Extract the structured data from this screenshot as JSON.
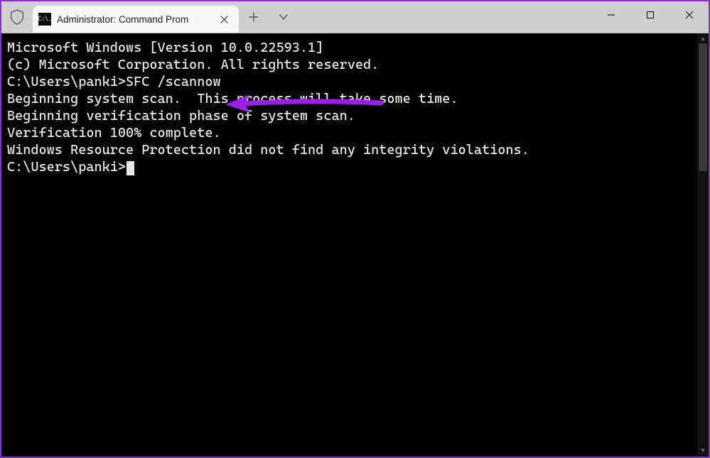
{
  "window": {
    "tab_title": "Administrator: Command Prom",
    "tab_icon_text": "C:\\."
  },
  "annotation": {
    "arrow_color": "#9b1fe8"
  },
  "terminal": {
    "lines": [
      "Microsoft Windows [Version 10.0.22593.1]",
      "(c) Microsoft Corporation. All rights reserved.",
      "",
      "C:\\Users\\panki>SFC /scannow",
      "",
      "Beginning system scan.  This process will take some time.",
      "",
      "Beginning verification phase of system scan.",
      "Verification 100% complete.",
      "",
      "Windows Resource Protection did not find any integrity violations.",
      "",
      "C:\\Users\\panki>"
    ],
    "cursor_after_line": 12
  }
}
